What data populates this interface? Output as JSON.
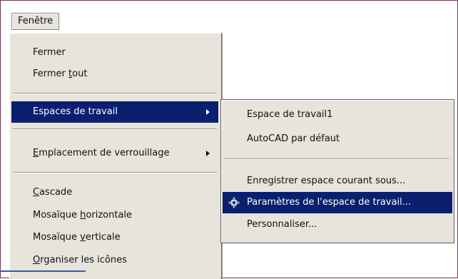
{
  "menubar": {
    "title": "Fenêtre"
  },
  "menu": {
    "items": [
      {
        "label": "Fermer"
      },
      {
        "label_pre": "Fermer ",
        "label_u": "t",
        "label_post": "out"
      },
      {
        "label": "Espaces de travail"
      },
      {
        "label_u": "E",
        "label_post": "mplacement de verrouillage"
      },
      {
        "label_u": "C",
        "label_post": "ascade"
      },
      {
        "label_pre": "Mosaïque ",
        "label_u": "h",
        "label_post": "orizontale"
      },
      {
        "label_pre": "Mosaïque ",
        "label_u": "v",
        "label_post": "erticale"
      },
      {
        "label_u": "O",
        "label_post": "rganiser les icônes"
      }
    ]
  },
  "submenu": {
    "items": [
      {
        "label": "Espace de travail1"
      },
      {
        "label": "AutoCAD par défaut"
      },
      {
        "label": "Enregistrer espace courant sous..."
      },
      {
        "label": "Paramètres de l'espace de travail...",
        "icon": "gear-icon"
      },
      {
        "label": "Personnaliser..."
      }
    ]
  },
  "colors": {
    "highlight": "#0a1f6e",
    "menu_bg": "#e7e4dc",
    "frame": "#6b3a52"
  }
}
